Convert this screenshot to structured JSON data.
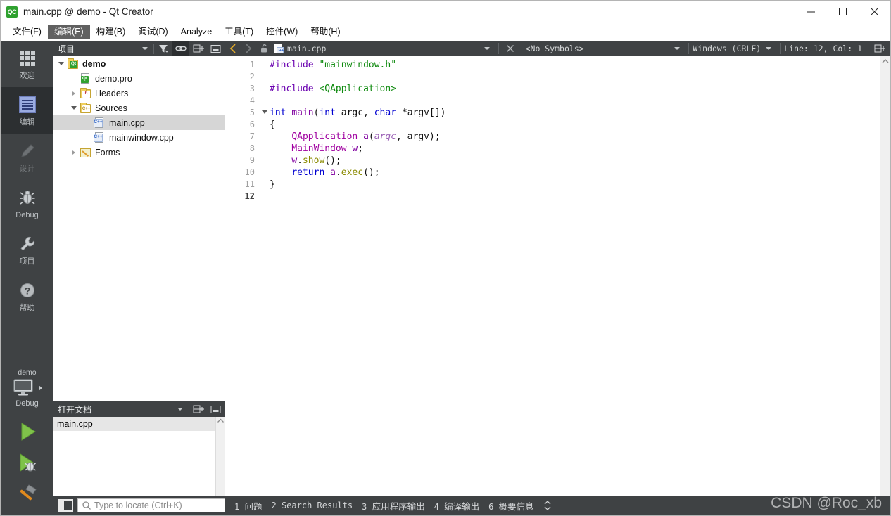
{
  "window": {
    "title": "main.cpp @ demo - Qt Creator",
    "app_icon": "qt-creator-icon",
    "minimize_label": "Minimize",
    "maximize_label": "Maximize",
    "close_label": "Close"
  },
  "menubar": {
    "items": [
      {
        "label": "文件(F)",
        "active": false
      },
      {
        "label": "编辑(E)",
        "active": true
      },
      {
        "label": "构建(B)",
        "active": false
      },
      {
        "label": "调试(D)",
        "active": false
      },
      {
        "label": "Analyze",
        "active": false
      },
      {
        "label": "工具(T)",
        "active": false
      },
      {
        "label": "控件(W)",
        "active": false
      },
      {
        "label": "帮助(H)",
        "active": false
      }
    ]
  },
  "modebar": {
    "items": [
      {
        "label": "欢迎",
        "icon": "grid-icon",
        "state": "normal"
      },
      {
        "label": "编辑",
        "icon": "document-lines-icon",
        "state": "selected"
      },
      {
        "label": "设计",
        "icon": "pencil-icon",
        "state": "disabled"
      },
      {
        "label": "Debug",
        "icon": "bug-icon",
        "state": "normal"
      },
      {
        "label": "项目",
        "icon": "wrench-icon",
        "state": "normal"
      },
      {
        "label": "帮助",
        "icon": "question-mark-icon",
        "state": "normal"
      }
    ],
    "kit": {
      "project": "demo",
      "build_config": "Debug",
      "icon": "monitor-icon"
    },
    "run_buttons": [
      {
        "name": "run",
        "icon": "green-play-icon"
      },
      {
        "name": "debug",
        "icon": "play-bug-icon"
      },
      {
        "name": "build",
        "icon": "hammer-icon"
      }
    ]
  },
  "project_panel": {
    "title": "项目",
    "toolbar": [
      {
        "name": "filter",
        "icon": "filter-icon",
        "active": false
      },
      {
        "name": "synchronize",
        "icon": "link-icon",
        "active": true
      },
      {
        "name": "split",
        "icon": "split-add-icon",
        "active": false
      },
      {
        "name": "close",
        "icon": "close-pane-icon",
        "active": false
      }
    ],
    "tree": [
      {
        "label": "demo",
        "icon": "qt-project-folder-icon",
        "indent": 0,
        "expander": "open",
        "bold": true,
        "selected": false
      },
      {
        "label": "demo.pro",
        "icon": "qt-pro-file-icon",
        "indent": 1,
        "expander": "none",
        "bold": false,
        "selected": false
      },
      {
        "label": "Headers",
        "icon": "headers-folder-icon",
        "indent": 1,
        "expander": "closed",
        "bold": false,
        "selected": false
      },
      {
        "label": "Sources",
        "icon": "sources-folder-icon",
        "indent": 1,
        "expander": "open",
        "bold": false,
        "selected": false
      },
      {
        "label": "main.cpp",
        "icon": "cpp-file-icon",
        "indent": 2,
        "expander": "none",
        "bold": false,
        "selected": true
      },
      {
        "label": "mainwindow.cpp",
        "icon": "cpp-file-icon",
        "indent": 2,
        "expander": "none",
        "bold": false,
        "selected": false
      },
      {
        "label": "Forms",
        "icon": "forms-folder-icon",
        "indent": 1,
        "expander": "closed",
        "bold": false,
        "selected": false
      }
    ]
  },
  "open_documents": {
    "title": "打开文档",
    "toolbar": [
      {
        "name": "split",
        "icon": "split-add-icon"
      },
      {
        "name": "close",
        "icon": "close-pane-icon"
      }
    ],
    "items": [
      {
        "label": "main.cpp",
        "selected": true
      }
    ]
  },
  "editor_toolbar": {
    "back_label": "Go Back",
    "forward_label": "Go Forward",
    "lock_label": "Make Writable",
    "file_name": "main.cpp",
    "file_icon": "cpp-file-icon",
    "close_label": "Close Document",
    "symbols": "<No Symbols>",
    "line_ending": "Windows (CRLF)",
    "cursor_position": "Line: 12, Col: 1",
    "split_label": "Split"
  },
  "editor": {
    "line_numbers": [
      "1",
      "2",
      "3",
      "4",
      "5",
      "6",
      "7",
      "8",
      "9",
      "10",
      "11",
      "12"
    ],
    "current_line": 12,
    "fold_marker_line": 5,
    "code_lines": [
      [
        {
          "t": "#include ",
          "c": "pre"
        },
        {
          "t": "\"mainwindow.h\"",
          "c": "str"
        }
      ],
      [],
      [
        {
          "t": "#include ",
          "c": "pre"
        },
        {
          "t": "<QApplication>",
          "c": "str"
        }
      ],
      [],
      [
        {
          "t": "int",
          "c": "kw"
        },
        {
          "t": " ",
          "c": "pln"
        },
        {
          "t": "main",
          "c": "var"
        },
        {
          "t": "(",
          "c": "pln"
        },
        {
          "t": "int",
          "c": "kw"
        },
        {
          "t": " argc, ",
          "c": "pln"
        },
        {
          "t": "char",
          "c": "kw"
        },
        {
          "t": " *argv[])",
          "c": "pln"
        }
      ],
      [
        {
          "t": "{",
          "c": "pln"
        }
      ],
      [
        {
          "t": "    ",
          "c": "pln"
        },
        {
          "t": "QApplication",
          "c": "type"
        },
        {
          "t": " ",
          "c": "pln"
        },
        {
          "t": "a",
          "c": "var"
        },
        {
          "t": "(",
          "c": "pln"
        },
        {
          "t": "argc",
          "c": "par"
        },
        {
          "t": ", argv);",
          "c": "pln"
        }
      ],
      [
        {
          "t": "    ",
          "c": "pln"
        },
        {
          "t": "MainWindow",
          "c": "type"
        },
        {
          "t": " ",
          "c": "pln"
        },
        {
          "t": "w",
          "c": "var"
        },
        {
          "t": ";",
          "c": "pln"
        }
      ],
      [
        {
          "t": "    ",
          "c": "pln"
        },
        {
          "t": "w",
          "c": "var"
        },
        {
          "t": ".",
          "c": "pln"
        },
        {
          "t": "show",
          "c": "fn"
        },
        {
          "t": "();",
          "c": "pln"
        }
      ],
      [
        {
          "t": "    ",
          "c": "pln"
        },
        {
          "t": "return",
          "c": "kw"
        },
        {
          "t": " ",
          "c": "pln"
        },
        {
          "t": "a",
          "c": "var"
        },
        {
          "t": ".",
          "c": "pln"
        },
        {
          "t": "exec",
          "c": "fn"
        },
        {
          "t": "();",
          "c": "pln"
        }
      ],
      [
        {
          "t": "}",
          "c": "pln"
        }
      ],
      []
    ]
  },
  "statusbar": {
    "sidebar_toggle": "toggle-sidebar-icon",
    "locator_placeholder": "Type to locate (Ctrl+K)",
    "locator_value": "",
    "panes": [
      {
        "num": "1",
        "label": "问题",
        "cn": true
      },
      {
        "num": "2",
        "label": "Search Results",
        "cn": false
      },
      {
        "num": "3",
        "label": "应用程序输出",
        "cn": true
      },
      {
        "num": "4",
        "label": "编译输出",
        "cn": true
      },
      {
        "num": "6",
        "label": "概要信息",
        "cn": true
      }
    ]
  },
  "watermark": "CSDN @Roc_xb",
  "colors": {
    "dark_chrome": "#3f4244",
    "dark_selected": "#2c2f31",
    "accent_green": "#2fa12f",
    "selection_grey": "#d6d6d6"
  }
}
